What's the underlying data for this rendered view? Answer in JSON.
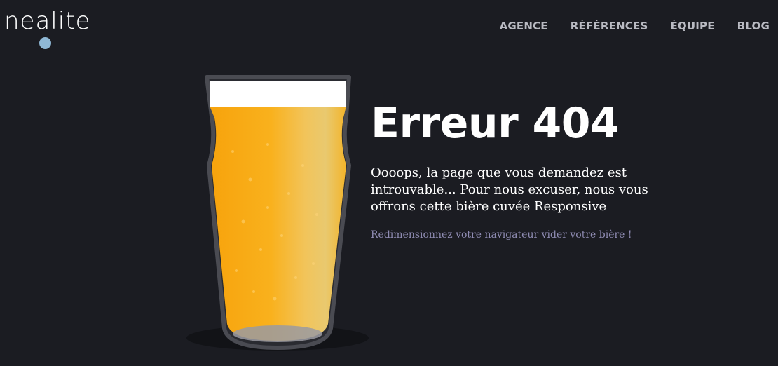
{
  "header": {
    "logo_text": "nealite",
    "nav": [
      {
        "label": "AGENCE"
      },
      {
        "label": "RÉFÉRENCES"
      },
      {
        "label": "ÉQUIPE"
      },
      {
        "label": "BLOG"
      }
    ]
  },
  "main": {
    "title": "Erreur 404",
    "message": "Oooops, la page que vous demandez est introuvable... Pour nous excuser, nous vous offrons cette bière cuvée Responsive",
    "hint": "Redimensionnez votre navigateur vider votre bière !"
  },
  "colors": {
    "background": "#1b1c22",
    "beer": "#f9b11d",
    "foam": "#ffffff",
    "accent_blue": "#8fb8d6",
    "hint_text": "#8f8cb3"
  },
  "icons": {
    "logo_dot": "blue-dot",
    "illustration": "beer-pint-glass"
  }
}
